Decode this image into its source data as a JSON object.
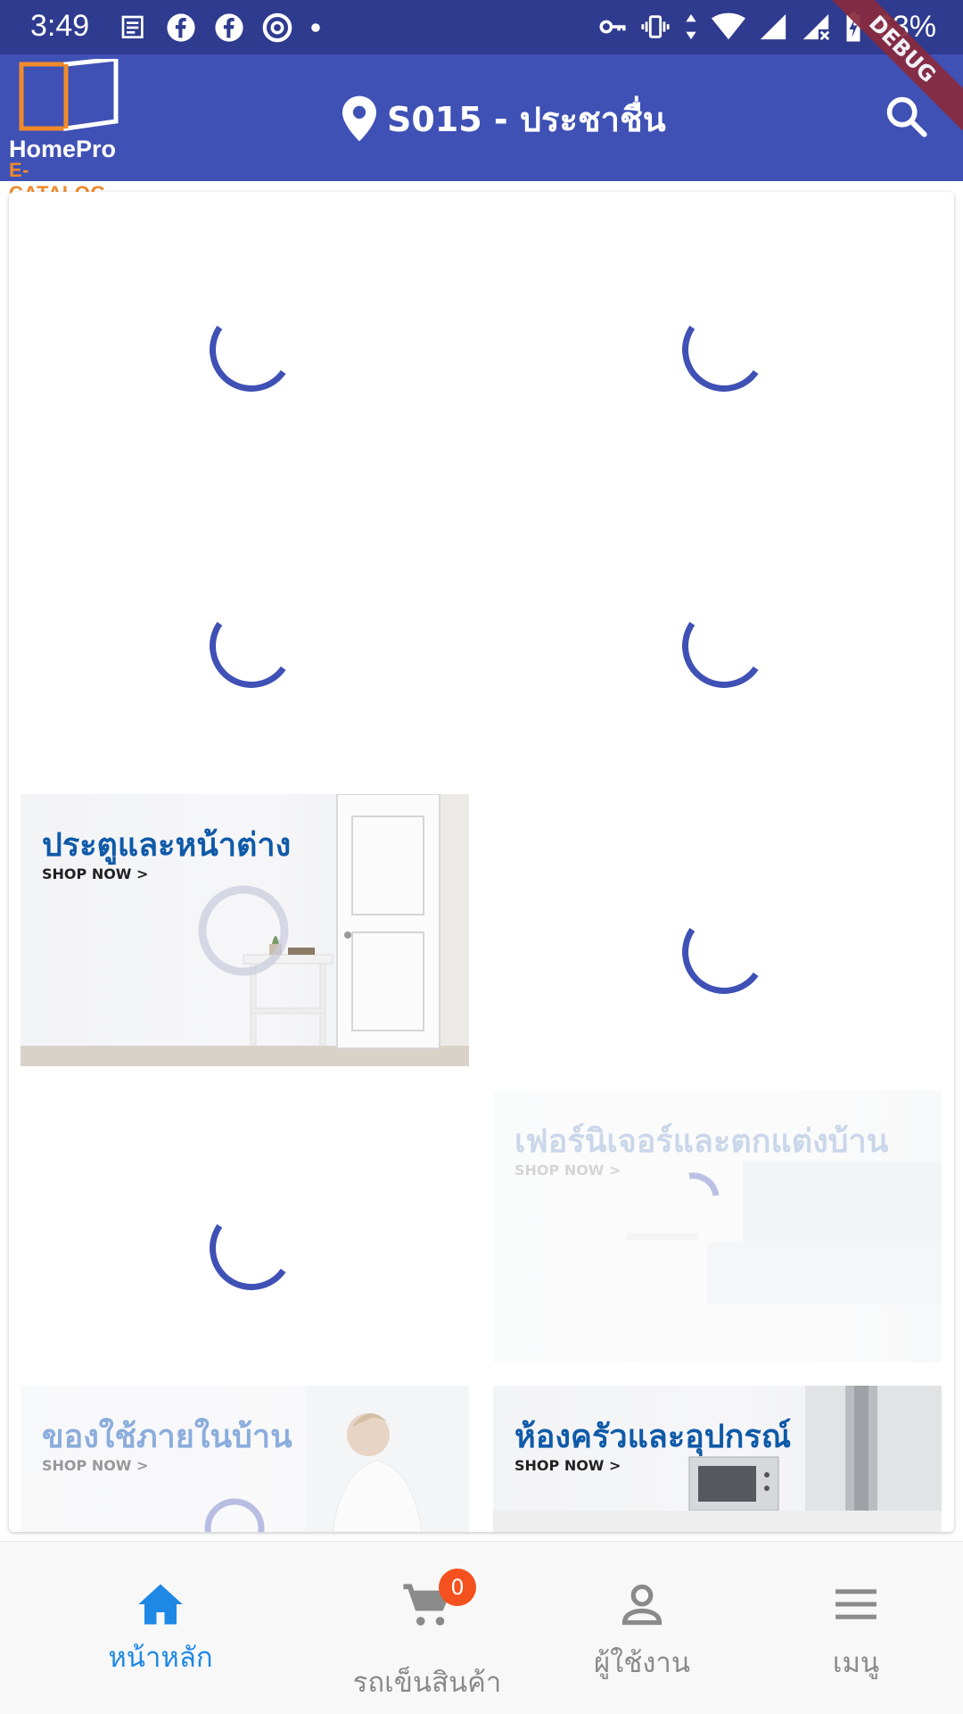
{
  "status_bar": {
    "time": "3:49",
    "battery": "63%"
  },
  "app_bar": {
    "logo_line1": "HomePro",
    "logo_line2": "E-CATALOG",
    "store": "S015 - ประชาชื่น"
  },
  "debug_banner": "DEBUG",
  "banners": {
    "doors": {
      "title": "ประตูและหน้าต่าง",
      "cta": "SHOP NOW >"
    },
    "furniture": {
      "title": "เฟอร์นิเจอร์และตกแต่งบ้าน",
      "cta": "SHOP NOW >"
    },
    "household": {
      "title": "ของใช้ภายในบ้าน",
      "cta": "SHOP NOW >"
    },
    "kitchen": {
      "title": "ห้องครัวและอุปกรณ์",
      "cta": "SHOP NOW >"
    }
  },
  "bottom_nav": {
    "home": "หน้าหลัก",
    "cart": "รถเข็นสินค้า",
    "cart_count": "0",
    "user": "ผู้ใช้งาน",
    "menu": "เมนู"
  },
  "colors": {
    "primary": "#3f51b5",
    "status_bar": "#2f3b8f",
    "active_nav": "#1e88e5",
    "badge": "#f4511e",
    "logo_accent": "#f08a2a"
  }
}
